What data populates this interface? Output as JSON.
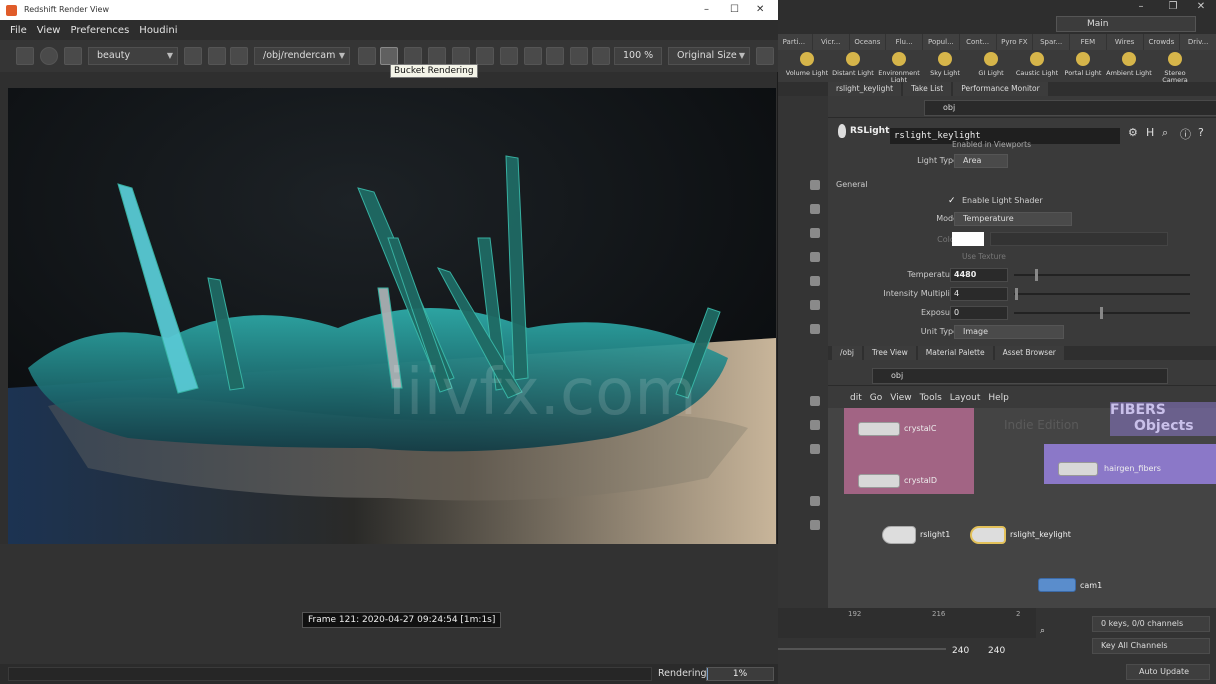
{
  "render_view": {
    "title": "Redshift Render View",
    "menu": [
      "File",
      "View",
      "Preferences",
      "Houdini"
    ],
    "aov": "beauty",
    "camera": "/obj/rendercam",
    "zoom": "100 %",
    "size_mode": "Original Size",
    "tooltip": "Bucket Rendering",
    "frame_label": "Frame 121: 2020-04-27 09:24:54 [1m:1s]",
    "watermark": "iiivfx.com",
    "status_label": "Rendering",
    "progress_text": "1%",
    "progress": 0.01
  },
  "houdini": {
    "desktop": "Main",
    "shelf_tabs": [
      "Parti...",
      "Vicr...",
      "Oceans",
      "Flu...",
      "Popul...",
      "Cont...",
      "Pyro FX",
      "Spar...",
      "FEM",
      "Wires",
      "Crowds",
      "Driv..."
    ],
    "shelf_tools": [
      "Volume Light",
      "Distant Light",
      "Environment Light",
      "Sky Light",
      "GI Light",
      "Caustic Light",
      "Portal Light",
      "Ambient Light",
      "Stereo Camera"
    ],
    "param_tabs": [
      "rslight_keylight",
      "Take List",
      "Performance Monitor"
    ],
    "path": "obj",
    "node_type": "RSLight",
    "node_name": "rslight_keylight",
    "params": {
      "light_type_label": "Light Type",
      "light_type": "Area",
      "general": "General",
      "enable_shader": "Enable Light Shader",
      "mode_label": "Mode",
      "mode": "Temperature",
      "color_label": "Color",
      "use_texture": "Use Texture",
      "temperature_label": "Temperature",
      "temperature": "4480",
      "intensity_label": "Intensity Multiplier",
      "intensity": "4",
      "exposure_label": "Exposure",
      "exposure": "0",
      "unit_label": "Unit Type",
      "unit": "Image",
      "enabled_viewports": "Enabled in Viewports"
    },
    "net_tabs": [
      "/obj",
      "Tree View",
      "Material Palette",
      "Asset Browser"
    ],
    "net_path": "obj",
    "net_menu": [
      "dit",
      "Go",
      "View",
      "Tools",
      "Layout",
      "Help"
    ],
    "nodes": {
      "crystalC": "crystalC",
      "crystalD": "crystalD",
      "rslight1": "rslight1",
      "rslight_keylight": "rslight_keylight",
      "cam1": "cam1",
      "hairgen": "hairgen_fibers",
      "fibers_label": "FIBERS",
      "objects_label": "Objects",
      "indie": "Indie Edition"
    },
    "timeline": {
      "ticks": [
        "192",
        "216",
        "2"
      ],
      "frame_start": "240",
      "frame_end": "240",
      "keys": "0 keys, 0/0 channels",
      "key_all": "Key All Channels",
      "auto_update": "Auto Update"
    }
  },
  "colors": {
    "accent": "#7aa0c9",
    "netbox_pink": "#b36a8f",
    "netbox_purple": "#8b78c8"
  }
}
